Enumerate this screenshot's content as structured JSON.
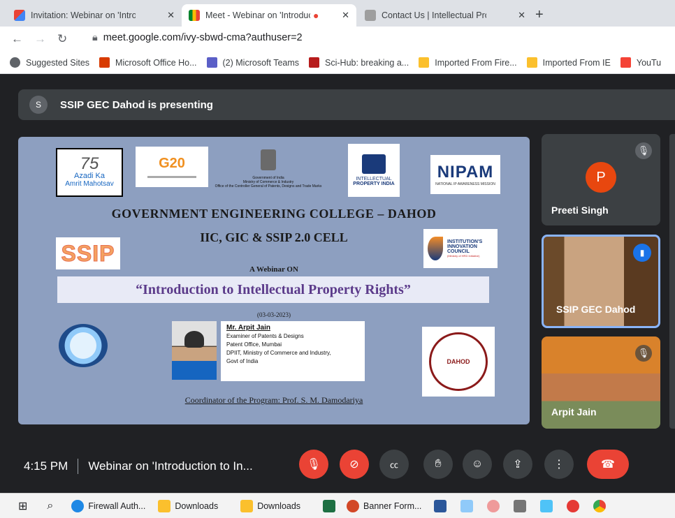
{
  "browser": {
    "tabs": [
      {
        "title": "Invitation: Webinar on 'Introducti",
        "icon": "gmail-icon"
      },
      {
        "title": "Meet - Webinar on 'Introduc",
        "icon": "meet-icon"
      },
      {
        "title": "Contact Us | Intellectual Property",
        "icon": "ipindia-icon"
      }
    ],
    "url": "meet.google.com/ivy-sbwd-cma?authuser=2",
    "bookmarks": [
      "Suggested Sites",
      "Microsoft Office Ho...",
      "(2) Microsoft Teams",
      "Sci-Hub: breaking a...",
      "Imported From Fire...",
      "Imported From IE",
      "YouTu"
    ]
  },
  "meet": {
    "presenting_avatar": "S",
    "presenting_text": "SSIP GEC Dahod is presenting",
    "time": "4:15 PM",
    "meeting_title": "Webinar on 'Introduction to In...",
    "participants": [
      {
        "name": "Preeti Singh",
        "initial": "P"
      },
      {
        "name": "SSIP GEC Dahod"
      },
      {
        "name": "Arpit Jain"
      }
    ]
  },
  "slide": {
    "logo_azadi_1": "75",
    "logo_azadi_2": "Azadi Ka",
    "logo_azadi_3": "Amrit Mahotsav",
    "logo_g20": "G20",
    "govt_line1": "Government of India",
    "govt_line2": "Ministry of Commerce & Industry",
    "govt_line3": "Office of the Controller General of Patents, Designs and Trade Marks",
    "ipindia_1": "INTELLECTUAL",
    "ipindia_2": "PROPERTY INDIA",
    "nipam": "NIPAM",
    "nipam_sub": "NATIONAL IP AWARENESS MISSION",
    "college": "GOVERNMENT ENGINEERING COLLEGE – DAHOD",
    "cell": "IIC, GIC & SSIP 2.0  CELL",
    "ssip": "SSIP",
    "iic_1": "INSTITUTION'S",
    "iic_2": "INNOVATION",
    "iic_3": "COUNCIL",
    "iic_4": "(Ministry of HRD Initiative)",
    "webinar_on": "A Webinar ON",
    "topic": "“Introduction to Intellectual Property Rights”",
    "date": "(03-03-2023)",
    "speaker_name": "Mr. Arpit Jain",
    "speaker_line1": "Examiner of Patents & Designs",
    "speaker_line2": "Patent Office, Mumbai",
    "speaker_line3": "DPIIT, Ministry of Commerce and Industry,",
    "speaker_line4": "Govt of India",
    "coordinator": "Coordinator of the Program: Prof. S. M. Damodariya",
    "gec_seal": "DAHOD"
  },
  "taskbar": {
    "items": [
      "Firewall Auth...",
      "Downloads",
      "Downloads",
      "Banner Form..."
    ]
  },
  "colors": {
    "end_call": "#ea4335",
    "accent_blue": "#8ab4f8",
    "meet_bg": "#202124"
  }
}
